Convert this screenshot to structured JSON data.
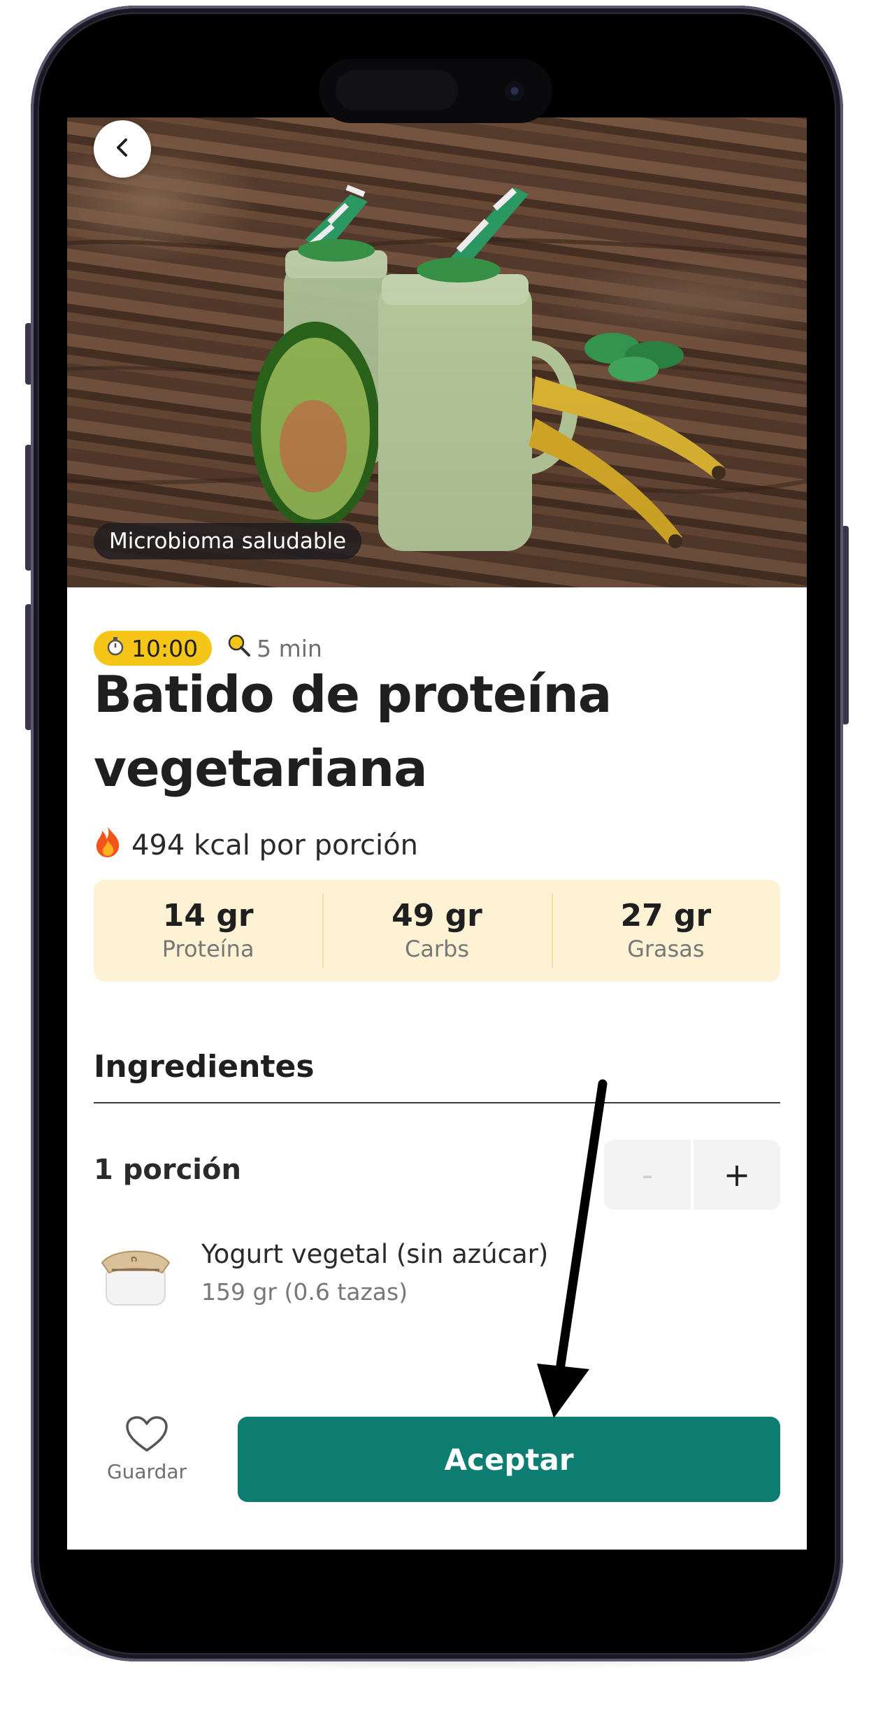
{
  "hero": {
    "badge": "Microbioma saludable"
  },
  "recipe": {
    "timer": "10:00",
    "prep_time": "5 min",
    "title_line1": "Batido de proteína",
    "title_line2": "vegetariana",
    "calories": "494 kcal por porción"
  },
  "macros": [
    {
      "value": "14 gr",
      "label": "Proteína"
    },
    {
      "value": "49 gr",
      "label": "Carbs"
    },
    {
      "value": "27 gr",
      "label": "Grasas"
    }
  ],
  "ingredients_section": {
    "title": "Ingredientes",
    "portion_label": "1 porción",
    "minus": "-",
    "plus": "+",
    "items": [
      {
        "name": "Yogurt vegetal (sin azúcar)",
        "quantity": "159 gr (0.6 tazas)"
      }
    ]
  },
  "bottom_bar": {
    "save_label": "Guardar",
    "accept_label": "Aceptar"
  },
  "colors": {
    "accent": "#0c7d70",
    "timer_badge": "#f5c518",
    "macros_background": "#fdf3d4"
  }
}
